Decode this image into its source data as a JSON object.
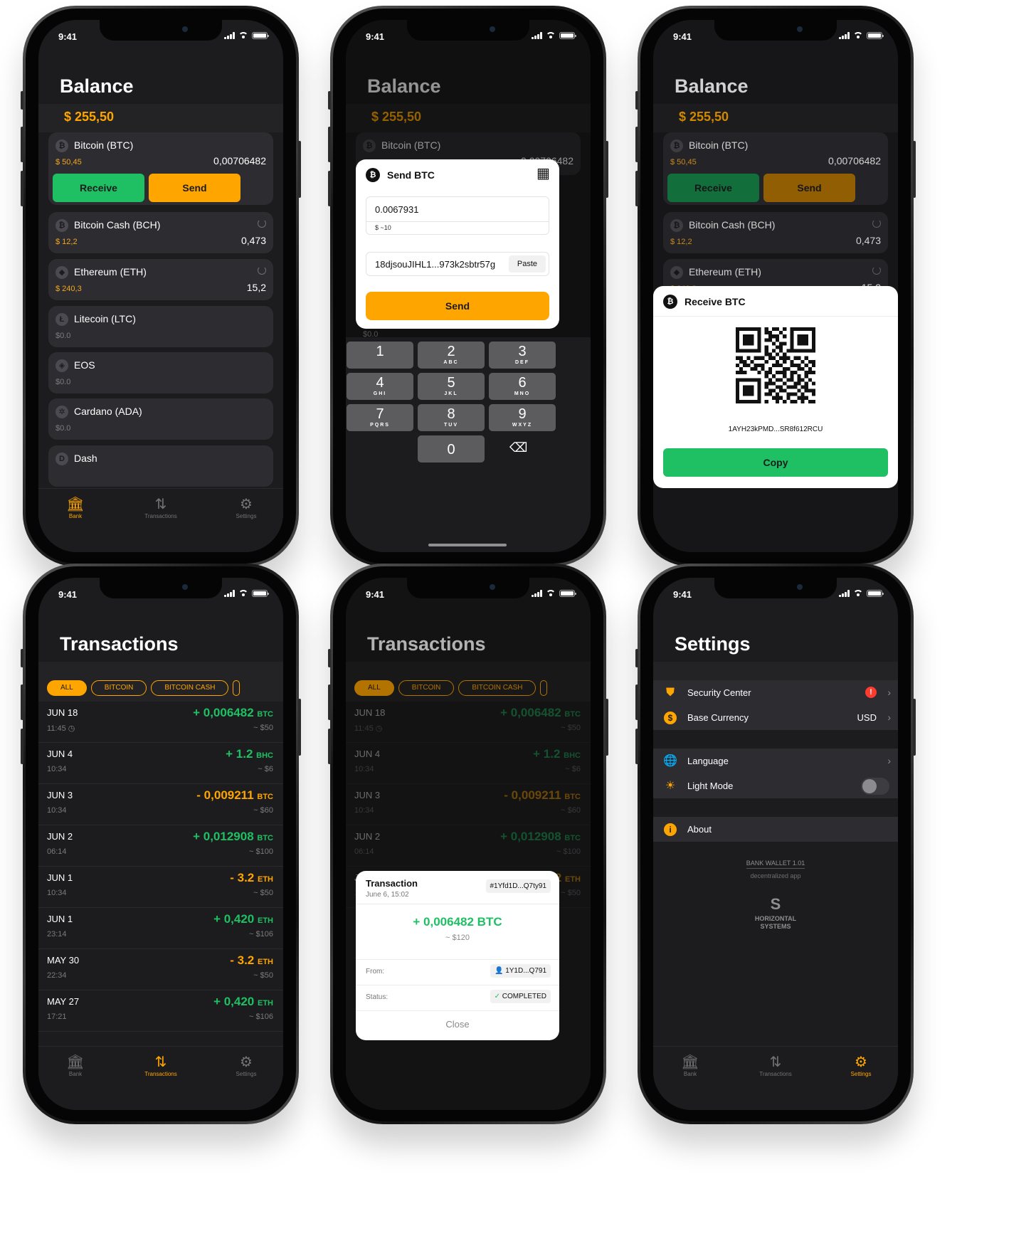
{
  "status": {
    "time": "9:41"
  },
  "balance": {
    "title": "Balance",
    "total": "$ 255,50",
    "coins": [
      {
        "name": "Bitcoin (BTC)",
        "fiat": "$ 50,45",
        "amount": "0,00706482",
        "icon": "bitcoin-icon",
        "glyph": "₿"
      },
      {
        "name": "Bitcoin Cash (BCH)",
        "fiat": "$ 12,2",
        "amount": "0,473",
        "icon": "bitcoin-cash-icon",
        "glyph": "₿"
      },
      {
        "name": "Ethereum (ETH)",
        "fiat": "$ 240,3",
        "amount": "15,2",
        "icon": "ethereum-icon",
        "glyph": "◆"
      },
      {
        "name": "Litecoin (LTC)",
        "fiat": "$0.0",
        "amount": "",
        "icon": "litecoin-icon",
        "glyph": "Ł"
      },
      {
        "name": "EOS",
        "fiat": "$0.0",
        "amount": "",
        "icon": "eos-icon",
        "glyph": "◈"
      },
      {
        "name": "Cardano (ADA)",
        "fiat": "$0.0",
        "amount": "",
        "icon": "cardano-icon",
        "glyph": "✲"
      },
      {
        "name": "Dash",
        "fiat": "",
        "amount": "",
        "icon": "dash-icon",
        "glyph": "D"
      }
    ],
    "receive_label": "Receive",
    "send_label": "Send",
    "partial_amount": "0,00706482",
    "partial_fiat": "$0.0"
  },
  "tabbar": {
    "bank": "Bank",
    "transactions": "Transactions",
    "settings": "Settings"
  },
  "send_modal": {
    "title": "Send BTC",
    "amount": "0.0067931",
    "amount_fiat": "$ ~10",
    "address": "18djsouJIHL1...973k2sbtr57g",
    "paste_label": "Paste",
    "send_label": "Send"
  },
  "keypad": [
    {
      "n": "1",
      "l": ""
    },
    {
      "n": "2",
      "l": "ABC"
    },
    {
      "n": "3",
      "l": "DEF"
    },
    {
      "n": "4",
      "l": "GHI"
    },
    {
      "n": "5",
      "l": "JKL"
    },
    {
      "n": "6",
      "l": "MNO"
    },
    {
      "n": "7",
      "l": "PQRS"
    },
    {
      "n": "8",
      "l": "TUV"
    },
    {
      "n": "9",
      "l": "WXYZ"
    },
    {
      "n": "0",
      "l": ""
    }
  ],
  "receive_modal": {
    "title": "Receive BTC",
    "address": "1AYH23kPMD...SR8f612RCU",
    "copy_label": "Copy"
  },
  "transactions": {
    "title": "Transactions",
    "filters": [
      "ALL",
      "BITCOIN",
      "BITCOIN CASH"
    ],
    "rows": [
      {
        "date": "JUN 18",
        "time": "11:45",
        "amount": "+ 0,006482",
        "unit": "BTC",
        "fiat": "~ $50",
        "sign": "pos",
        "pending": true
      },
      {
        "date": "JUN 4",
        "time": "10:34",
        "amount": "+ 1.2",
        "unit": "BHC",
        "fiat": "~ $6",
        "sign": "pos"
      },
      {
        "date": "JUN 3",
        "time": "10:34",
        "amount": "- 0,009211",
        "unit": "BTC",
        "fiat": "~ $60",
        "sign": "neg"
      },
      {
        "date": "JUN 2",
        "time": "06:14",
        "amount": "+ 0,012908",
        "unit": "BTC",
        "fiat": "~ $100",
        "sign": "pos"
      },
      {
        "date": "JUN 1",
        "time": "10:34",
        "amount": "- 3.2",
        "unit": "ETH",
        "fiat": "~ $50",
        "sign": "neg"
      },
      {
        "date": "JUN 1",
        "time": "23:14",
        "amount": "+ 0,420",
        "unit": "ETH",
        "fiat": "~ $106",
        "sign": "pos"
      },
      {
        "date": "MAY 30",
        "time": "22:34",
        "amount": "- 3.2",
        "unit": "ETH",
        "fiat": "~ $50",
        "sign": "neg"
      },
      {
        "date": "MAY 27",
        "time": "17:21",
        "amount": "+ 0,420",
        "unit": "ETH",
        "fiat": "~ $106",
        "sign": "pos"
      }
    ]
  },
  "tx_modal": {
    "title": "Transaction",
    "date": "June 6, 15:02",
    "hash": "#1Yfd1D...Q7ty91",
    "amount": "+ 0,006482 BTC",
    "fiat": "~ $120",
    "from_label": "From:",
    "from_value": "1Y1D...Q791",
    "status_label": "Status:",
    "status_value": "COMPLETED",
    "close_label": "Close"
  },
  "settings": {
    "title": "Settings",
    "security": "Security Center",
    "base_currency": "Base Currency",
    "base_currency_value": "USD",
    "language": "Language",
    "light_mode": "Light Mode",
    "about": "About",
    "version": "BANK WALLET 1.01",
    "tagline": "decentralized app",
    "brand_line1": "HORIZONTAL",
    "brand_line2": "SYSTEMS"
  },
  "colors": {
    "orange": "#ffa500",
    "green": "#1fc063",
    "dark": "#1c1c1e",
    "card": "#2d2d31"
  }
}
